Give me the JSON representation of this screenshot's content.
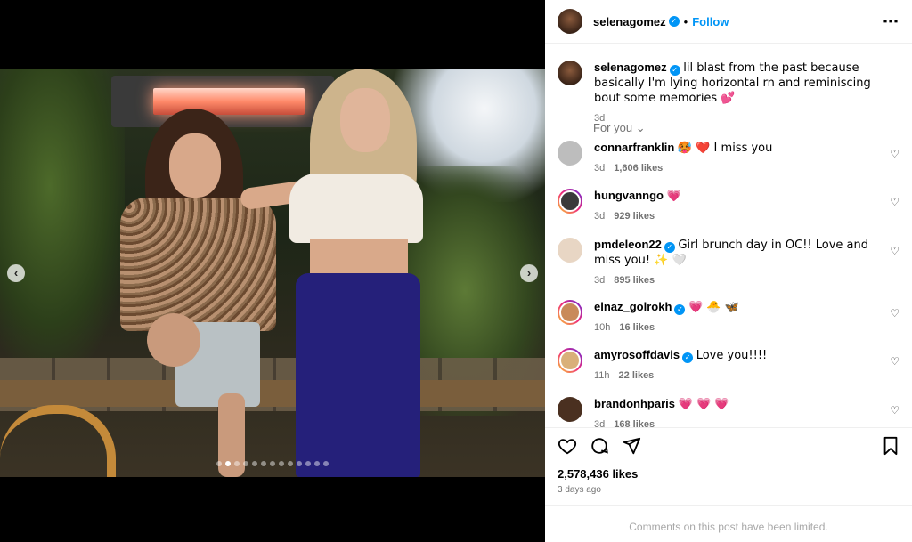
{
  "post": {
    "owner": "selenagomez",
    "follow_label": "Follow",
    "separator": "•",
    "more_icon": "more-horizontal-icon",
    "caption": {
      "username": "selenagomez",
      "text": "lil blast from the past because basically I'm lying horizontal rn and reminiscing bout some memories 💕",
      "time": "3d"
    },
    "for_you_label": "For you",
    "carousel": {
      "total": 13,
      "active": 2
    }
  },
  "comments": [
    {
      "username": "connarfranklin",
      "verified": false,
      "text": "🥵 ❤️ I miss you",
      "time": "3d",
      "likes": "1,606 likes"
    },
    {
      "username": "hungvanngo",
      "verified": false,
      "text": "💗",
      "time": "3d",
      "likes": "929 likes"
    },
    {
      "username": "pmdeleon22",
      "verified": true,
      "text": "Girl brunch day in OC!! Love and miss you! ✨ 🤍",
      "time": "3d",
      "likes": "895 likes"
    },
    {
      "username": "elnaz_golrokh",
      "verified": true,
      "text": "💗 🐣 🦋",
      "time": "10h",
      "likes": "16 likes"
    },
    {
      "username": "amyrosoffdavis",
      "verified": true,
      "text": "Love you!!!!",
      "time": "11h",
      "likes": "22 likes"
    },
    {
      "username": "brandonhparis",
      "verified": false,
      "text": "💗 💗 💗",
      "time": "3d",
      "likes": "168 likes"
    }
  ],
  "footer": {
    "likes_count": "2,578,436 likes",
    "time_ago": "3 days ago",
    "limited_notice": "Comments on this post have been limited."
  },
  "colors": {
    "accent": "#0095f6",
    "muted": "#737373",
    "heart": "#ed4956"
  }
}
